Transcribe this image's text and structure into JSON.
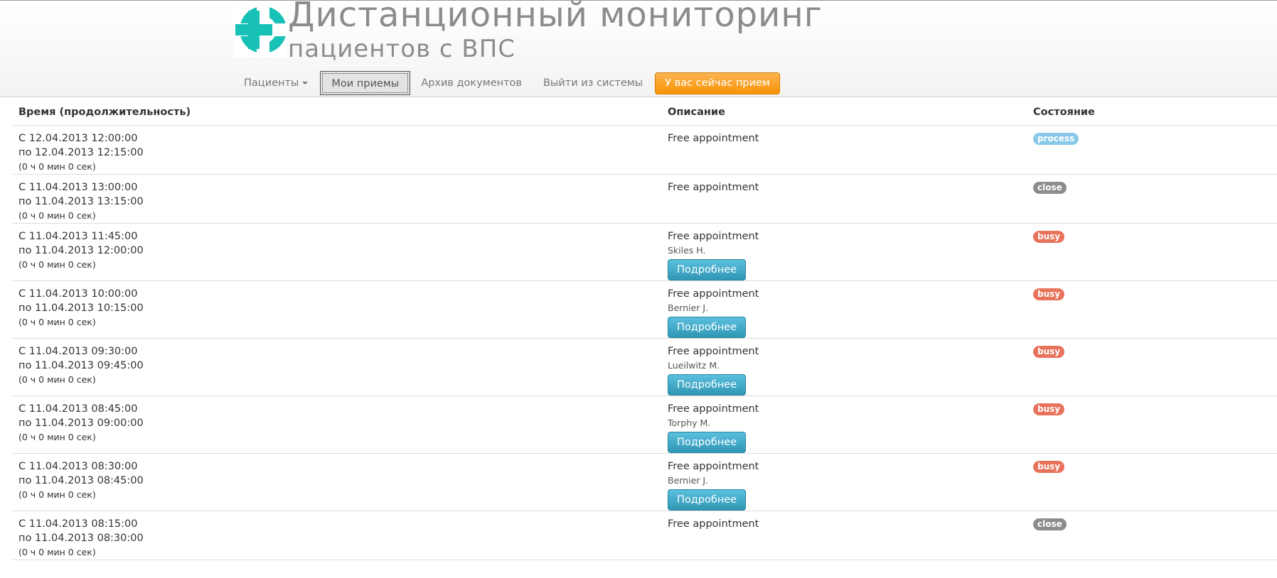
{
  "header": {
    "title_main": "Дистанционный мониторинг",
    "title_sub": "пациентов с ВПС",
    "logo_color": "#18c1b5"
  },
  "nav": {
    "patients": "Пациенты",
    "my_appointments": "Мои приемы",
    "archive": "Архив документов",
    "logout": "Выйти из системы",
    "current_appointment": "У вас сейчас прием"
  },
  "table": {
    "headers": {
      "time": "Время (продолжительность)",
      "description": "Описание",
      "status": "Состояние"
    },
    "rows": [
      {
        "from": "С 12.04.2013 12:00:00",
        "to": "по 12.04.2013 12:15:00",
        "duration": "(0 ч 0 мин 0 сек)",
        "description": "Free appointment",
        "status": "process"
      },
      {
        "from": "С 11.04.2013 13:00:00",
        "to": "по 11.04.2013 13:15:00",
        "duration": "(0 ч 0 мин 0 сек)",
        "description": "Free appointment",
        "status": "close"
      },
      {
        "from": "С 11.04.2013 11:45:00",
        "to": "по 11.04.2013 12:00:00",
        "duration": "(0 ч 0 мин 0 сек)",
        "description": "Free appointment",
        "patient": "Skiles H.",
        "button": "Подробнее",
        "status": "busy"
      },
      {
        "from": "С 11.04.2013 10:00:00",
        "to": "по 11.04.2013 10:15:00",
        "duration": "(0 ч 0 мин 0 сек)",
        "description": "Free appointment",
        "patient": "Bernier J.",
        "button": "Подробнее",
        "status": "busy"
      },
      {
        "from": "С 11.04.2013 09:30:00",
        "to": "по 11.04.2013 09:45:00",
        "duration": "(0 ч 0 мин 0 сек)",
        "description": "Free appointment",
        "patient": "Lueilwitz M.",
        "button": "Подробнее",
        "status": "busy"
      },
      {
        "from": "С 11.04.2013 08:45:00",
        "to": "по 11.04.2013 09:00:00",
        "duration": "(0 ч 0 мин 0 сек)",
        "description": "Free appointment",
        "patient": "Torphy M.",
        "button": "Подробнее",
        "status": "busy"
      },
      {
        "from": "С 11.04.2013 08:30:00",
        "to": "по 11.04.2013 08:45:00",
        "duration": "(0 ч 0 мин 0 сек)",
        "description": "Free appointment",
        "patient": "Bernier J.",
        "button": "Подробнее",
        "status": "busy"
      },
      {
        "from": "С 11.04.2013 08:15:00",
        "to": "по 11.04.2013 08:30:00",
        "duration": "(0 ч 0 мин 0 сек)",
        "description": "Free appointment",
        "status": "close"
      }
    ]
  },
  "status_colors": {
    "process": "#89c9e8",
    "close": "#8c8c8c",
    "busy": "#e8735a"
  }
}
